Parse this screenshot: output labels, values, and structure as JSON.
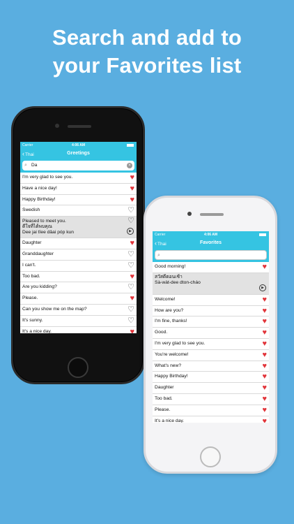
{
  "headline": {
    "line1": "Search and add to",
    "line2": "your Favorites list"
  },
  "left_phone": {
    "status": {
      "carrier": "Carrier",
      "time": "4:06 AM"
    },
    "nav": {
      "back": "Thai",
      "title": "Greetings"
    },
    "search": {
      "value": "Da"
    },
    "rows": [
      {
        "text": "I'm very glad to see you.",
        "fav": true
      },
      {
        "text": "Have a nice day!",
        "fav": true
      },
      {
        "text": "Happy Birthday!",
        "fav": true
      },
      {
        "text": "Swedish",
        "fav": false
      }
    ],
    "expanded": {
      "text": "Pleased to meet you.",
      "thai": "ดีใจที่ได้พบคุณ",
      "roman": "Dee jai tîee dâai póp kun",
      "fav": false
    },
    "rows2": [
      {
        "text": "Daughter",
        "fav": true
      },
      {
        "text": "Granddaughter",
        "fav": false
      },
      {
        "text": "I can't.",
        "fav": false
      },
      {
        "text": "Too bad.",
        "fav": true
      },
      {
        "text": "Are you kidding?",
        "fav": false
      },
      {
        "text": "Please.",
        "fav": true
      },
      {
        "text": "Can you show me on the map?",
        "fav": false
      },
      {
        "text": "It's sunny.",
        "fav": false
      },
      {
        "text": "It's a nice day.",
        "fav": true
      }
    ]
  },
  "right_phone": {
    "status": {
      "carrier": "Carrier",
      "time": "4:06 AM"
    },
    "nav": {
      "back": "Thai",
      "title": "Favorites"
    },
    "search": {
      "value": ""
    },
    "rows": [
      {
        "text": "Good morning!",
        "fav": true
      }
    ],
    "expanded": {
      "thai": "สวัสดีตอนเช้า",
      "roman": "Sà-wàt-dee dton-cháo"
    },
    "rows2": [
      {
        "text": "Welcome!",
        "fav": true
      },
      {
        "text": "How are you?",
        "fav": true
      },
      {
        "text": "I'm fine, thanks!",
        "fav": true
      },
      {
        "text": "Good.",
        "fav": true
      },
      {
        "text": "I'm very glad to see you.",
        "fav": true
      },
      {
        "text": "You're welcome!",
        "fav": true
      },
      {
        "text": "What's new?",
        "fav": true
      },
      {
        "text": "Happy Birthday!",
        "fav": true
      },
      {
        "text": "Daughter",
        "fav": true
      },
      {
        "text": "Too bad.",
        "fav": true
      },
      {
        "text": "Please.",
        "fav": true
      },
      {
        "text": "It's a nice day.",
        "fav": true
      }
    ]
  },
  "icons": {
    "heart_on": "filled-heart-icon",
    "heart_off": "outline-heart-icon",
    "play": "play-icon",
    "search": "magnifier-icon",
    "clear": "clear-icon"
  },
  "colors": {
    "background": "#5aaee0",
    "bar": "#35c4e2",
    "heart": "#e2353b",
    "filler": "#b6e6f3"
  }
}
